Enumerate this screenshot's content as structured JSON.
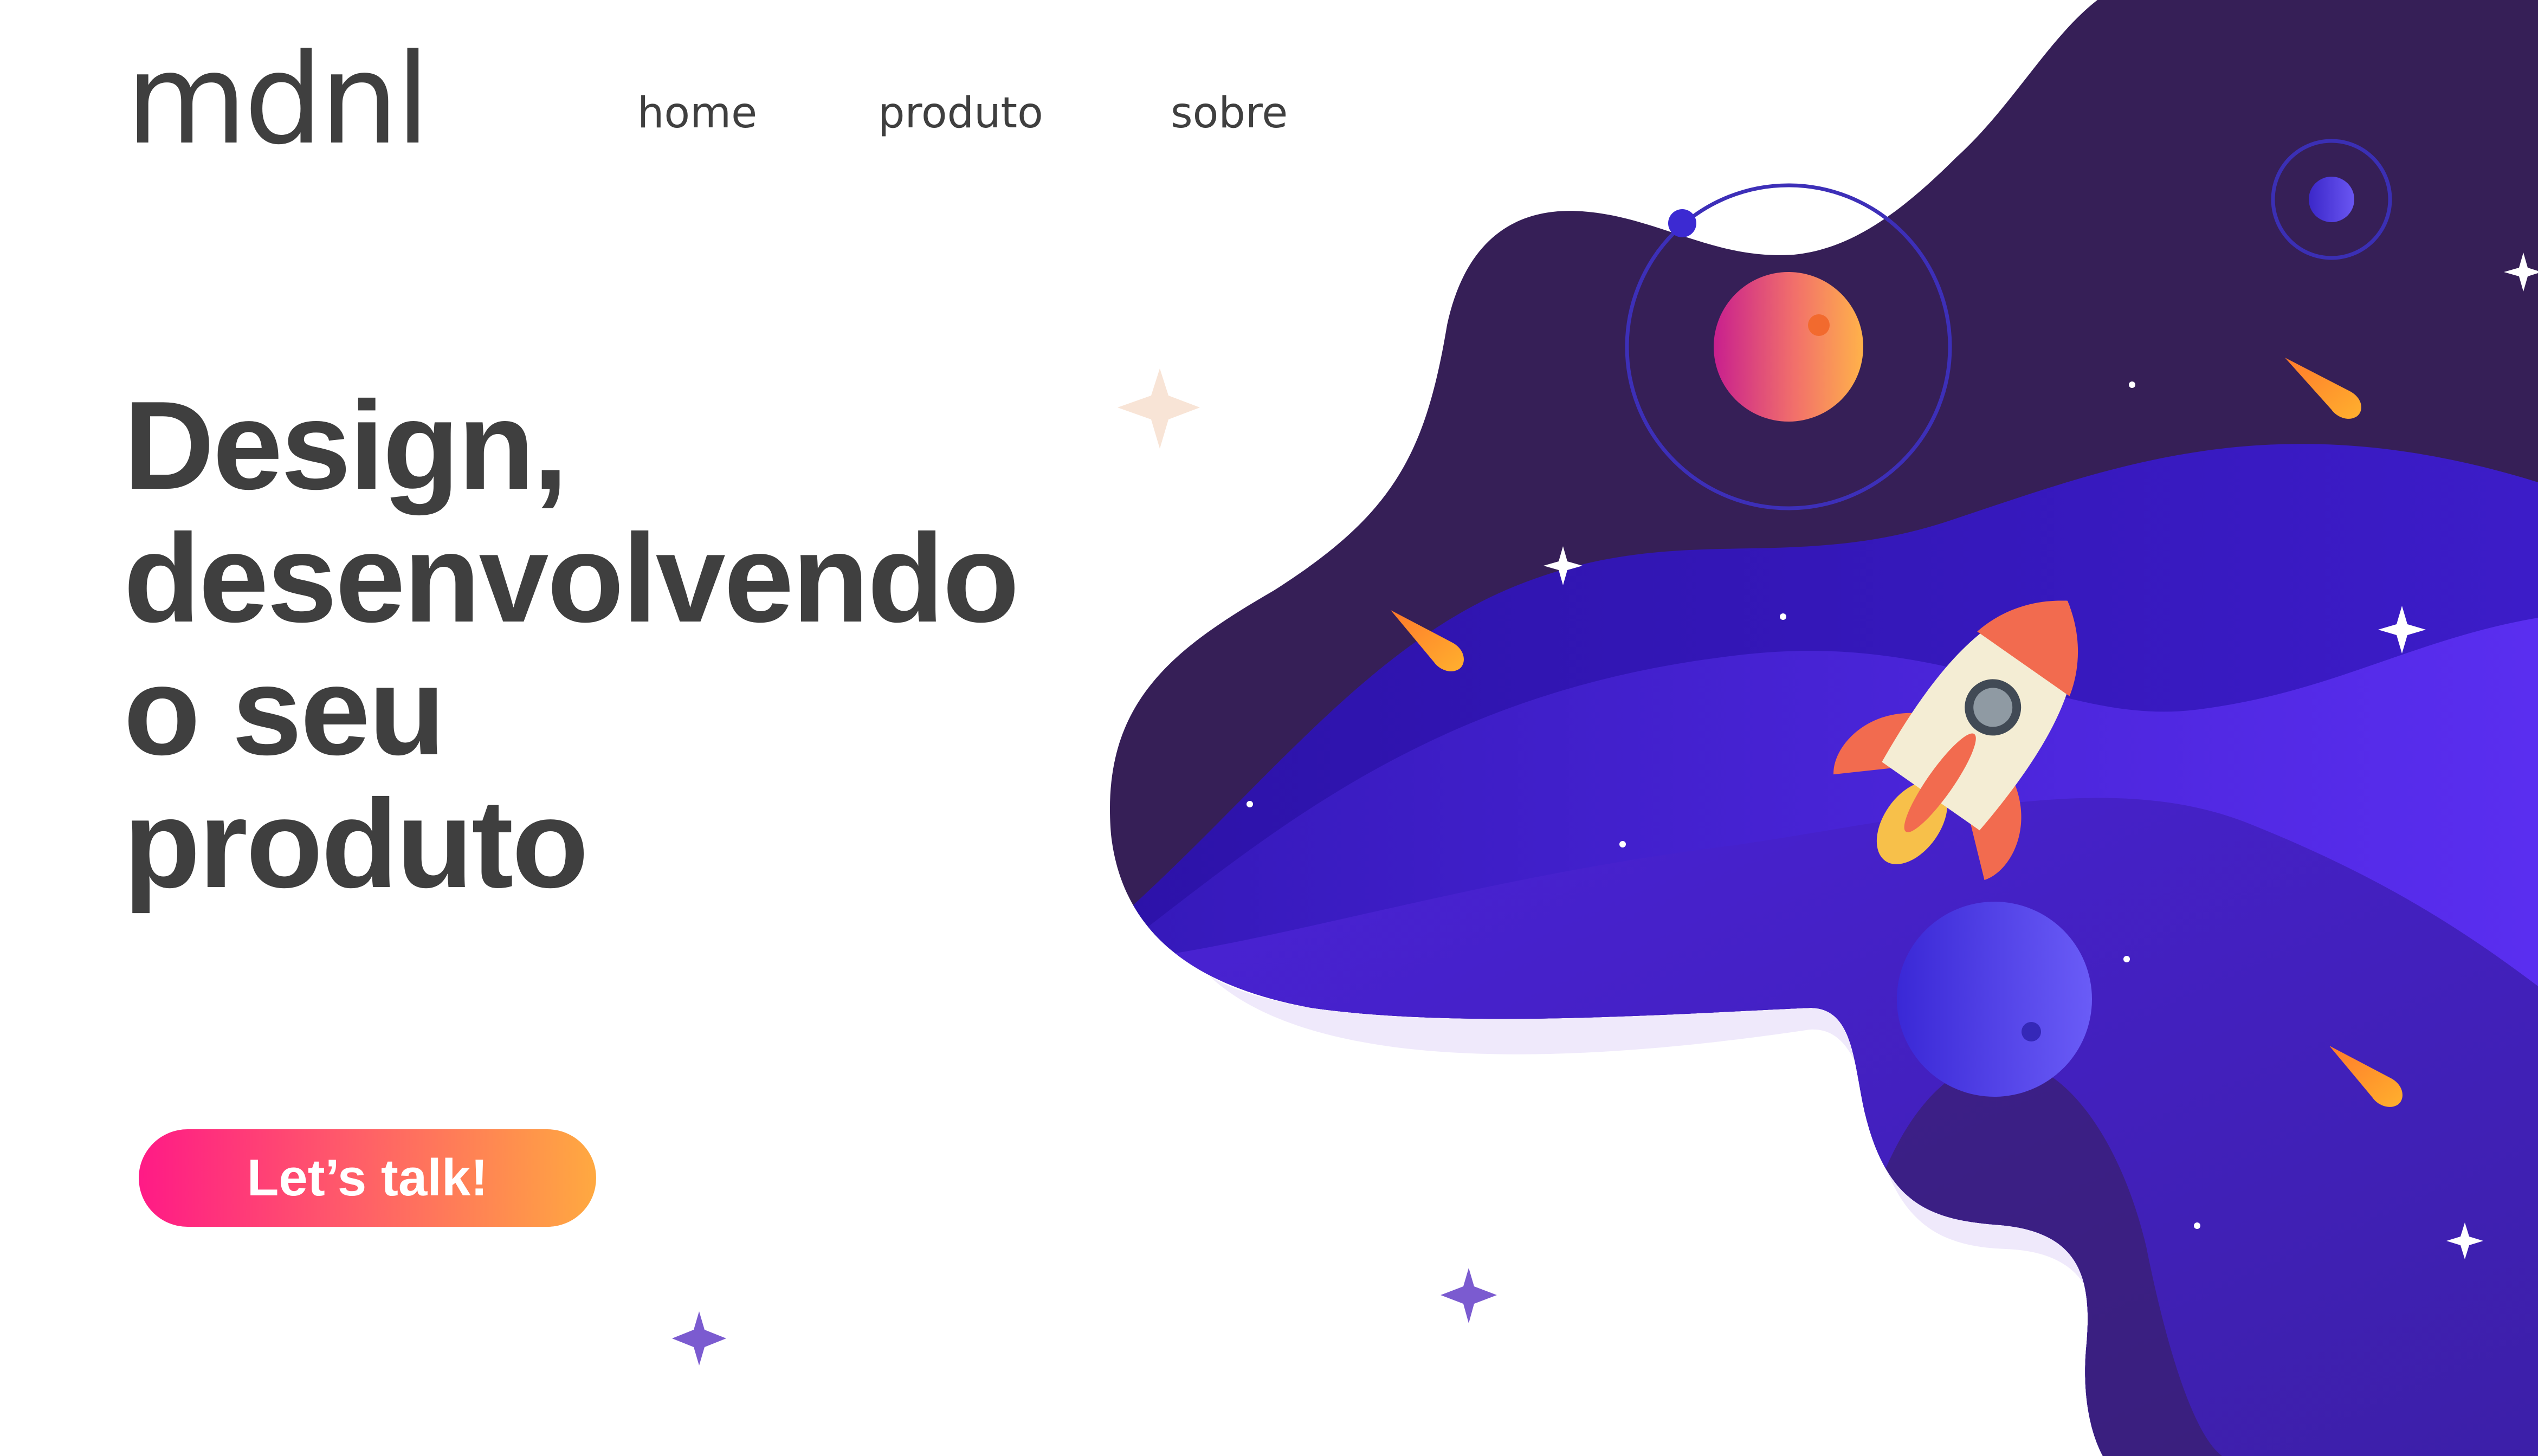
{
  "header": {
    "brand": "mdnl",
    "nav": [
      {
        "label": "home"
      },
      {
        "label": "produto"
      },
      {
        "label": "sobre"
      }
    ]
  },
  "hero": {
    "title_lines": [
      "Design,",
      "desenvolvendo",
      "o seu",
      "produto"
    ],
    "cta_label": "Let’s talk!"
  },
  "illustration": {
    "icons": [
      "space-blob",
      "planet-icon",
      "orbit-ring",
      "rocket-icon",
      "comet-icon",
      "sparkle-star-icon",
      "moon-icon"
    ]
  },
  "colors": {
    "text": "#3f3f3f",
    "space_dark": "#361f57",
    "space_violet": "#3a18c4",
    "space_purple": "#5a2ee8",
    "cta_start": "#ff1a86",
    "cta_end": "#ffa940",
    "comet": "#ffa62b"
  }
}
